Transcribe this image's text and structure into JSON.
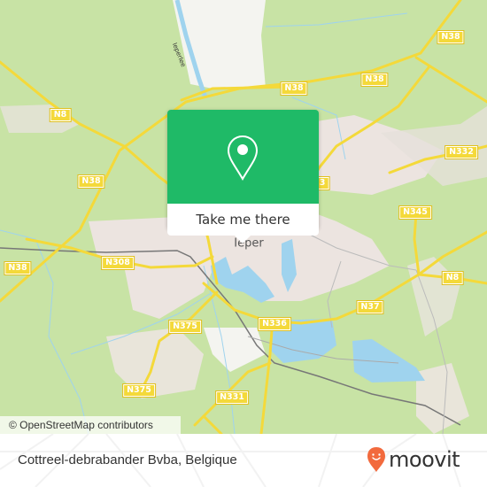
{
  "map": {
    "city_label": "Ieper",
    "canal_label": "Ieperlee",
    "road_labels": [
      {
        "id": "n8-west",
        "text": "N8"
      },
      {
        "id": "n38-west",
        "text": "N38"
      },
      {
        "id": "n38-far-west",
        "text": "N38"
      },
      {
        "id": "n38-north-mid",
        "text": "N38"
      },
      {
        "id": "n38-north-east",
        "text": "N38"
      },
      {
        "id": "n38-top-right",
        "text": "N38"
      },
      {
        "id": "n332",
        "text": "N332"
      },
      {
        "id": "n38-partial",
        "text": "3"
      },
      {
        "id": "n345",
        "text": "N345"
      },
      {
        "id": "n8-east",
        "text": "N8"
      },
      {
        "id": "n308",
        "text": "N308"
      },
      {
        "id": "n37",
        "text": "N37"
      },
      {
        "id": "n336",
        "text": "N336"
      },
      {
        "id": "n375-north",
        "text": "N375"
      },
      {
        "id": "n375-south",
        "text": "N375"
      },
      {
        "id": "n331",
        "text": "N331"
      }
    ],
    "attribution": "© OpenStreetMap contributors",
    "colors": {
      "land": "#c8e3a5",
      "urban": "#ece4e0",
      "water": "#9fd3ee",
      "road": "#f4d93a",
      "rail": "#777777"
    }
  },
  "popup": {
    "button_label": "Take me there",
    "pin_icon": "location-pin-icon",
    "color": "#1fba67"
  },
  "footer": {
    "place_name": "Cottreel-debrabander Bvba, Belgique",
    "brand": "moovit",
    "brand_color": "#f26a3d"
  }
}
